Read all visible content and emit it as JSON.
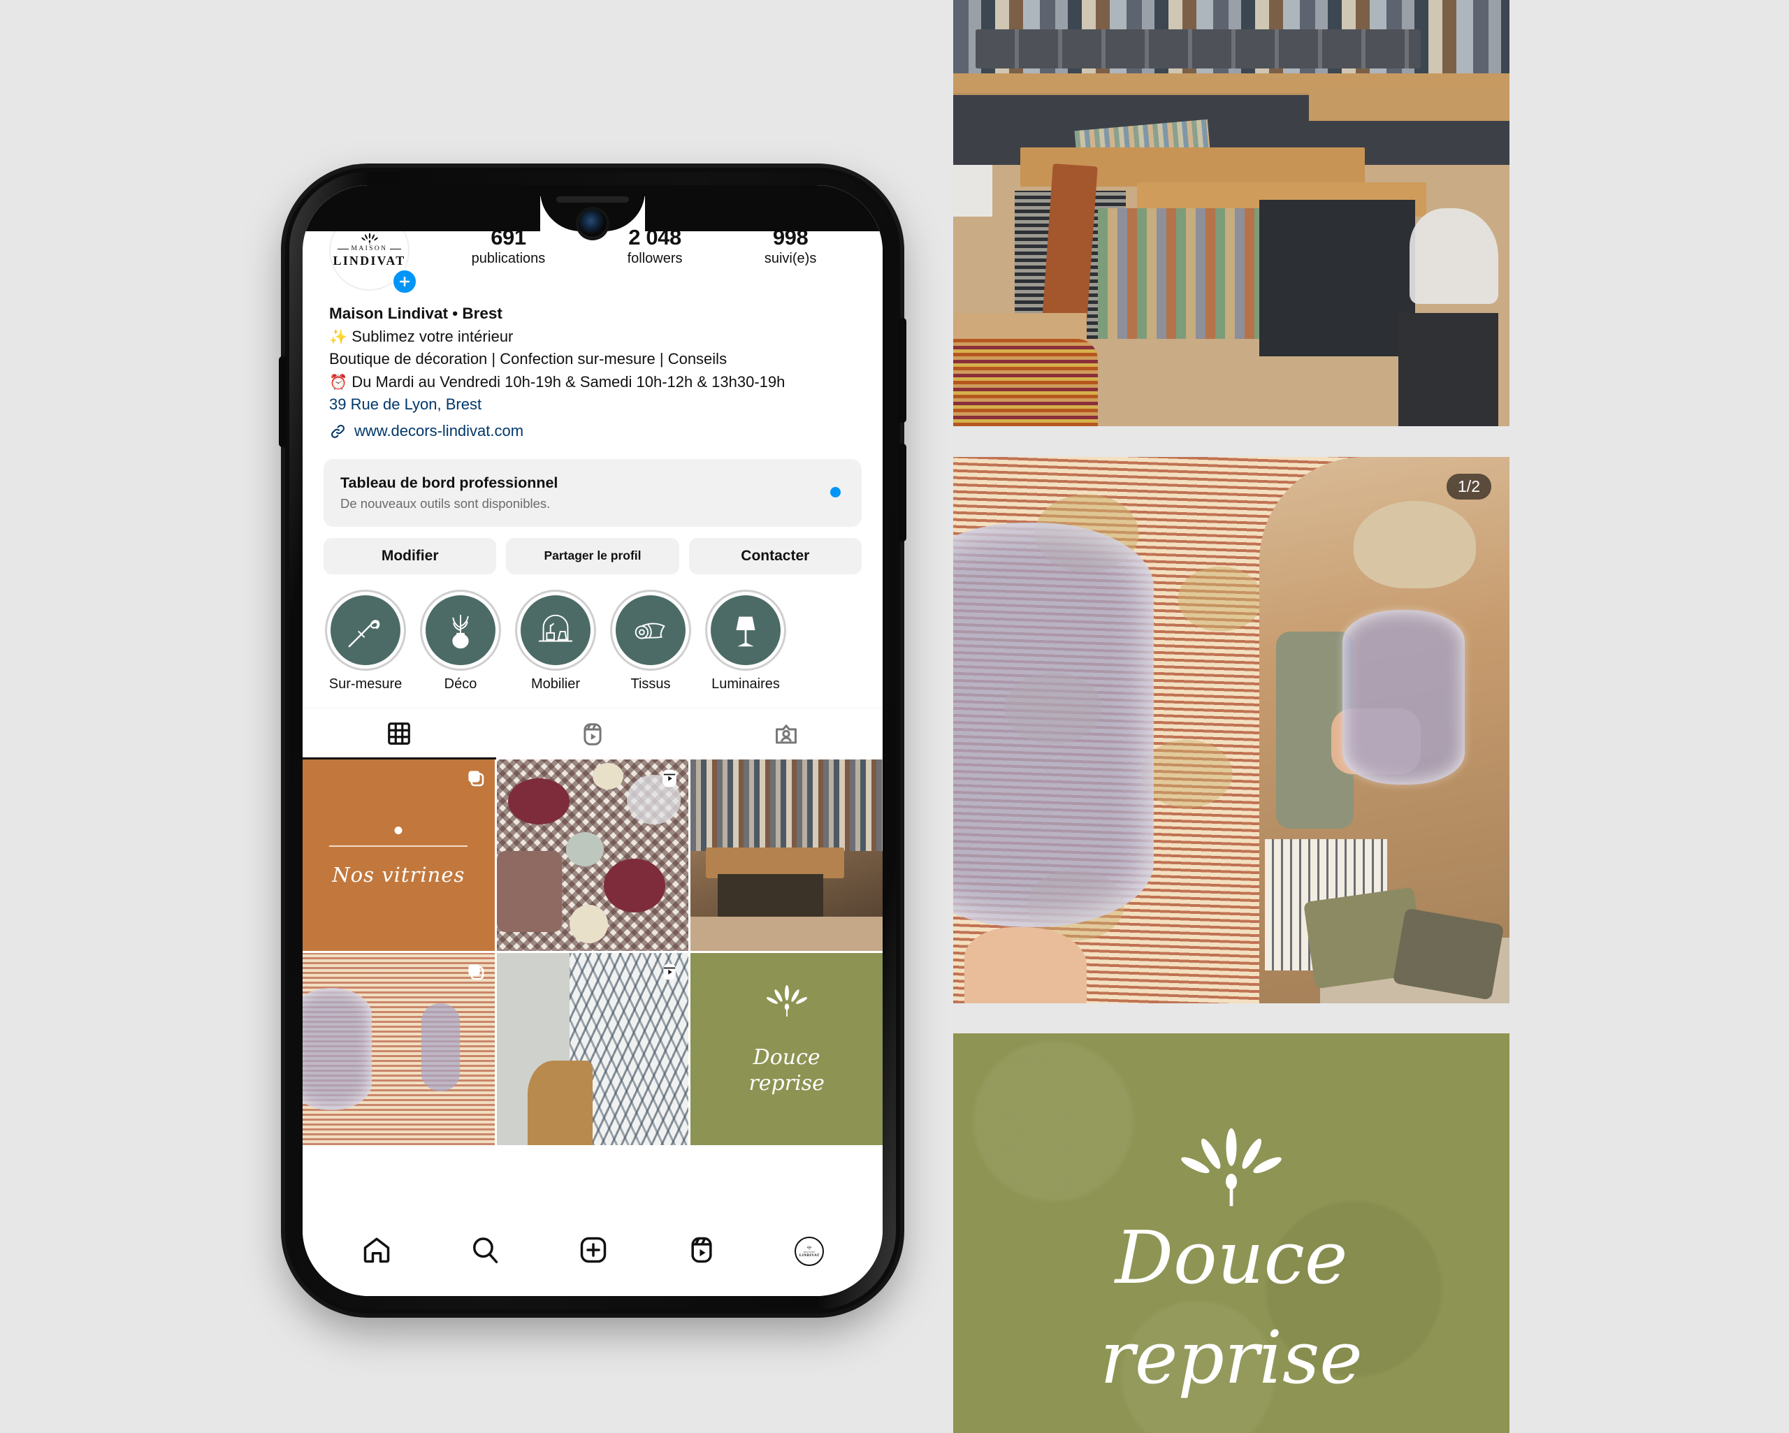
{
  "profile": {
    "logo": {
      "word_top": "MAISON",
      "word_bottom": "LINDIVAT"
    },
    "add_badge_icon": "plus-icon",
    "stats": [
      {
        "num": "691",
        "label": "publications"
      },
      {
        "num": "2 048",
        "label": "followers"
      },
      {
        "num": "998",
        "label": "suivi(e)s"
      }
    ],
    "display_name": "Maison Lindivat • Brest",
    "bio_lines": [
      {
        "emoji": "✨",
        "text": "Sublimez votre intérieur",
        "style": "normal"
      },
      {
        "emoji": "",
        "text": "Boutique de décoration | Confection sur-mesure | Conseils",
        "style": "normal"
      },
      {
        "emoji": "⏰",
        "text": "Du Mardi au Vendredi 10h-19h & Samedi 10h-12h & 13h30-19h",
        "style": "normal"
      },
      {
        "emoji": "",
        "text": "39 Rue de Lyon, Brest",
        "style": "link"
      }
    ],
    "website": "www.decors-lindivat.com",
    "link_icon": "link-chain-icon"
  },
  "dashboard": {
    "title": "Tableau de bord professionnel",
    "subtitle": "De nouveaux outils sont disponibles.",
    "dot_color": "#0095f6"
  },
  "actions": {
    "edit": "Modifier",
    "share": "Partager le profil",
    "contact": "Contacter"
  },
  "highlights": [
    {
      "label": "Sur-mesure",
      "icon": "needle-thread-icon"
    },
    {
      "label": "Déco",
      "icon": "vase-plant-icon"
    },
    {
      "label": "Mobilier",
      "icon": "furniture-arch-icon"
    },
    {
      "label": "Tissus",
      "icon": "fabric-roll-icon"
    },
    {
      "label": "Luminaires",
      "icon": "lamp-icon"
    }
  ],
  "tabs": [
    {
      "name": "grid",
      "icon": "grid-icon",
      "active": true
    },
    {
      "name": "reels",
      "icon": "reels-icon",
      "active": false
    },
    {
      "name": "tagged",
      "icon": "tagged-icon",
      "active": false
    }
  ],
  "grid_posts": [
    {
      "type": "carousel",
      "badge_icon": "carousel-icon",
      "caption": "Nos vitrines",
      "art": "terracotta-card"
    },
    {
      "type": "reel",
      "badge_icon": "reels-icon",
      "caption": "",
      "art": "plates-gingham-photo"
    },
    {
      "type": "photo",
      "badge_icon": "",
      "caption": "",
      "art": "showroom-fabrics-photo"
    },
    {
      "type": "carousel",
      "badge_icon": "carousel-icon",
      "caption": "",
      "art": "glass-vase-photo"
    },
    {
      "type": "reel",
      "badge_icon": "reels-icon",
      "caption": "",
      "art": "fern-wallpaper-photo"
    },
    {
      "type": "photo",
      "badge_icon": "",
      "caption_line1": "Douce",
      "caption_line2": "reprise",
      "art": "olive-card"
    }
  ],
  "bottom_nav": [
    {
      "name": "home",
      "icon": "home-icon"
    },
    {
      "name": "search",
      "icon": "search-icon"
    },
    {
      "name": "create",
      "icon": "plus-square-icon"
    },
    {
      "name": "reels",
      "icon": "reels-icon"
    },
    {
      "name": "profile",
      "icon": "profile-avatar-icon"
    }
  ],
  "photos": {
    "showroom": {
      "alt": "Boutique interior with fabric sample books on wooden table"
    },
    "glassware": {
      "alt": "Hands holding ribbed purple glass vase in front of patterned wallpaper",
      "carousel_badge": "1/2"
    },
    "douce": {
      "line1": "Douce",
      "line2": "reprise"
    }
  },
  "colors": {
    "instagram_blue": "#0095f6",
    "link_blue": "#00376b",
    "highlight_green": "#4c6b66",
    "terracotta": "#c2783d",
    "olive": "#8e9453",
    "page_background": "#e7e7e7"
  }
}
